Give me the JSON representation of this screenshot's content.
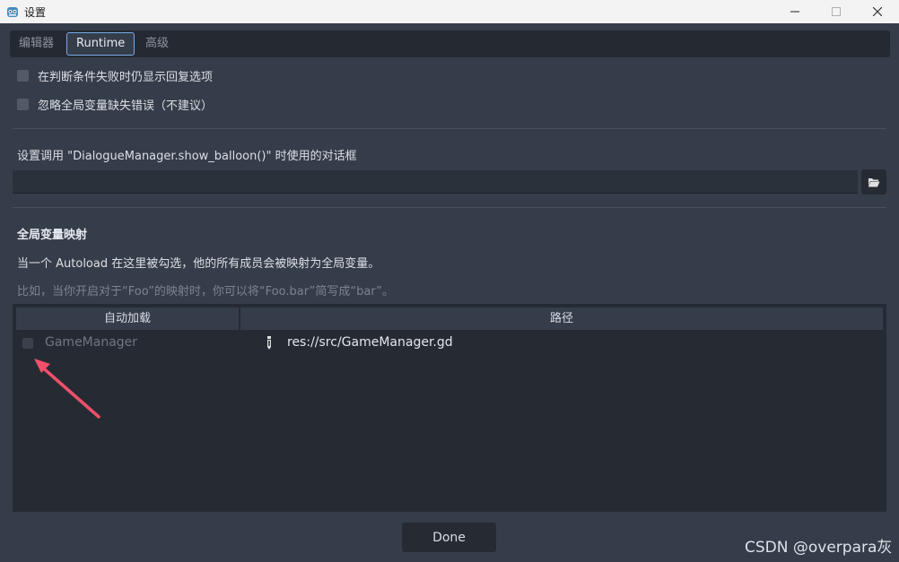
{
  "window": {
    "title": "设置",
    "logo_icon": "godot-icon",
    "controls": [
      "minimize-icon",
      "maximize-icon",
      "close-icon"
    ]
  },
  "tabs": [
    {
      "label": "编辑器",
      "active": false
    },
    {
      "label": "Runtime",
      "active": true
    },
    {
      "label": "高级",
      "active": false
    }
  ],
  "options": [
    {
      "label": "在判断条件失败时仍显示回复选项",
      "checked": false
    },
    {
      "label": "忽略全局变量缺失错误（不建议）",
      "checked": false
    }
  ],
  "balloon": {
    "label": "设置调用 \"DialogueManager.show_balloon()\" 时使用的对话框",
    "value": "",
    "browse_icon": "folder-open-icon"
  },
  "globals": {
    "title": "全局变量映射",
    "description": "当一个 Autoload 在这里被勾选，他的所有成员会被映射为全局变量。",
    "hint": "比如，当你开启对于“Foo”的映射时，你可以将“Foo.bar”简写成“bar”。",
    "table": {
      "columns": [
        "自动加载",
        "路径"
      ],
      "rows": [
        {
          "name": "GameManager",
          "checked": false,
          "path": "res://src/GameManager.gd",
          "icon": "script-icon"
        }
      ]
    }
  },
  "annotation": {
    "color": "#f0506a"
  },
  "footer": {
    "done_label": "Done"
  },
  "watermark": "CSDN @overpara灰",
  "colors": {
    "accent": "#75a9e8",
    "background": "#363d4a",
    "panel": "#262b33"
  }
}
